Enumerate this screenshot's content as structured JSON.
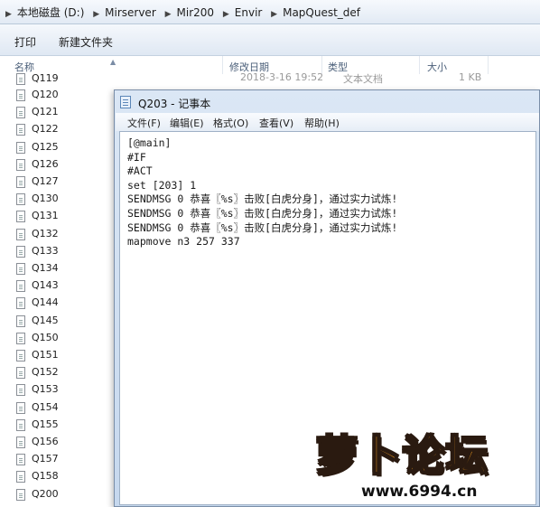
{
  "explorer": {
    "breadcrumbs": [
      "本地磁盘 (D:)",
      "Mirserver",
      "Mir200",
      "Envir",
      "MapQuest_def"
    ],
    "toolbar": {
      "print_label": "打印",
      "new_folder_label": "新建文件夹"
    },
    "columns": {
      "name": "名称",
      "modified": "修改日期",
      "type": "类型",
      "size": "大小"
    },
    "partial_row": {
      "name": "Q119",
      "modified": "2018-3-16 19:52",
      "type": "文本文档",
      "size": "1 KB"
    },
    "files": [
      "Q120",
      "Q121",
      "Q122",
      "Q125",
      "Q126",
      "Q127",
      "Q130",
      "Q131",
      "Q132",
      "Q133",
      "Q134",
      "Q143",
      "Q144",
      "Q145",
      "Q150",
      "Q151",
      "Q152",
      "Q153",
      "Q154",
      "Q155",
      "Q156",
      "Q157",
      "Q158",
      "Q200"
    ]
  },
  "notepad": {
    "title": "Q203 - 记事本",
    "menu": [
      "文件(F)",
      "编辑(E)",
      "格式(O)",
      "查看(V)",
      "帮助(H)"
    ],
    "lines": [
      "[@main]",
      "#IF",
      "#ACT",
      "set [203] 1",
      "SENDMSG 0 恭喜〖%s〗击败[白虎分身]，通过实力试炼!",
      "SENDMSG 0 恭喜〖%s〗击败[白虎分身]，通过实力试炼!",
      "SENDMSG 0 恭喜〖%s〗击败[白虎分身]，通过实力试炼!",
      "mapmove n3 257 337"
    ]
  },
  "watermark": {
    "logo_text": "萝卜论坛",
    "url": "www.6994.cn"
  },
  "colors": {
    "accent": "#fca31e",
    "window_frame": "#c6d8ee"
  }
}
